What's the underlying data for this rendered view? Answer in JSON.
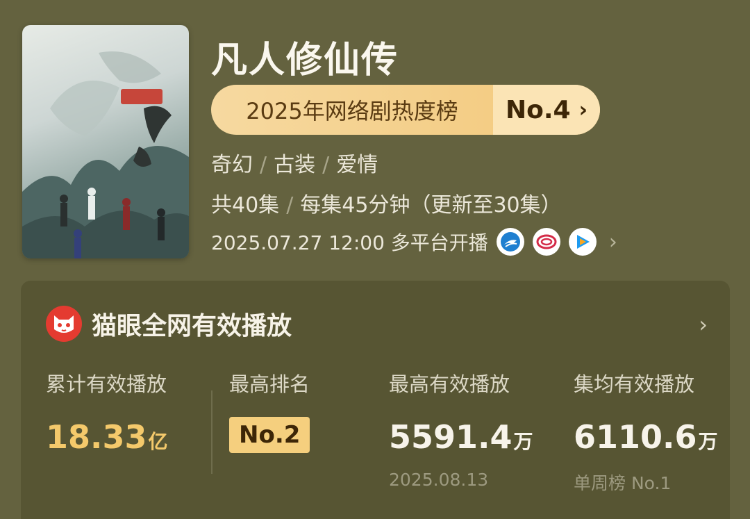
{
  "drama": {
    "title": "凡人修仙传",
    "rank_label": "2025年网络剧热度榜",
    "rank_value": "No.4",
    "rank_chevron": "›",
    "genres": [
      "奇幻",
      "古装",
      "爱情"
    ],
    "episodes_total": "共40集",
    "episode_length": "每集45分钟（更新至30集）",
    "premiere": "2025.07.27 12:00 多平台开播",
    "platform_icons": [
      "youku-icon",
      "mango-tv-icon",
      "tencent-video-icon"
    ],
    "more_chevron": "›"
  },
  "maoyan": {
    "title": "猫眼全网有效播放",
    "more_chevron": "›",
    "stats": {
      "cumulative": {
        "label": "累计有效播放",
        "value": "18.33",
        "unit": "亿"
      },
      "highest_rank": {
        "label": "最高排名",
        "value": "No.2"
      },
      "highest_play": {
        "label": "最高有效播放",
        "value": "5591.4",
        "unit": "万",
        "date": "2025.08.13"
      },
      "avg_play": {
        "label": "集均有效播放",
        "value": "6110.6",
        "unit": "万",
        "note": "单周榜 No.1"
      }
    }
  },
  "colors": {
    "background": "#64623f",
    "card": "#575533",
    "gold": "#f4c96b",
    "pill": "#f6d9a0",
    "maoyan_red": "#e43b30"
  }
}
